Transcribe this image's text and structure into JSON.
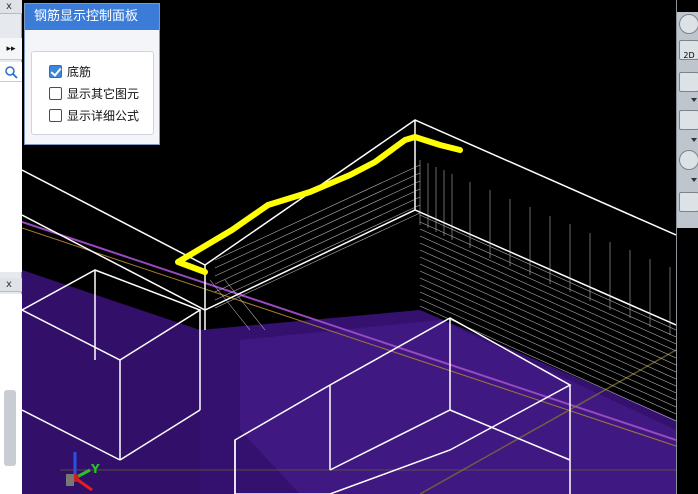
{
  "panel": {
    "title": "钢筋显示控制面板",
    "options": [
      {
        "label": "底筋",
        "checked": true
      },
      {
        "label": "显示其它图元",
        "checked": false
      },
      {
        "label": "显示详细公式",
        "checked": false
      }
    ]
  },
  "left_strip": {
    "close_glyph": "x",
    "expand_glyph": "▸▸"
  },
  "axis": {
    "y_label": "Y"
  },
  "right_toolbar": {
    "zoom_label": "2D",
    "tools": [
      "orbit-icon",
      "view-2d-icon",
      "view-top-icon",
      "view-box-icon",
      "rotate-icon",
      "table-icon"
    ]
  },
  "colors": {
    "annotation_stroke": "#ffff00",
    "panel_title_bg": "#3a7cd8",
    "structure_lines": "#ffffff",
    "slab_fill": "#3b1477",
    "beam_line": "#9a49c0",
    "axis_y": "#27c227",
    "axis_z": "#2c4fe6",
    "axis_x": "#e02020"
  }
}
